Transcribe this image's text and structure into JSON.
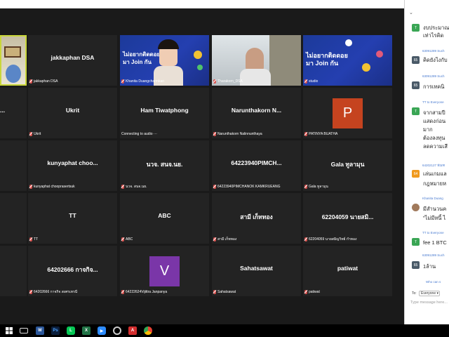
{
  "gallery": {
    "tiles": [
      {
        "name": "",
        "footer": ""
      },
      {
        "name": "jakkaphan DSA",
        "footer": "jakkaphan DSA"
      },
      {
        "name": "",
        "footer": "Khanita Duangcharmkan",
        "banner": "ไม่อยากติดดอย\nมา Join กัน"
      },
      {
        "name": "",
        "footer": "Tharakorn_DSA"
      },
      {
        "name": "",
        "footer": "studio",
        "banner": "ไม่อยากติดดอย\nมา Join กัน"
      },
      {
        "name": "...",
        "footer": ""
      },
      {
        "name": "Ukrit",
        "footer": "Ukrit"
      },
      {
        "name": "Ham Tiwatphong",
        "footer": "Connecting to audio ···"
      },
      {
        "name": "Narunthakorn  N...",
        "footer": "Narunthakorn Nalinnunthaya"
      },
      {
        "name": "",
        "footer": "PATINYA BUATHA",
        "avatar": "P"
      },
      {
        "name": "",
        "footer": ""
      },
      {
        "name": "kunyaphat  choo...",
        "footer": "kunyaphat chooprasertsuk"
      },
      {
        "name": "นวจ. สนจ.นย.",
        "footer": "นวจ. สนจ.นย."
      },
      {
        "name": "64223940PIMCH...",
        "footer": "64223940PIMCHANOK KAMKRUEANG"
      },
      {
        "name": "Gala ทูลามุน",
        "footer": "Gala ทูลามุน"
      },
      {
        "name": "",
        "footer": ""
      },
      {
        "name": "TT",
        "footer": "TT"
      },
      {
        "name": "ABC",
        "footer": "ABC"
      },
      {
        "name": "สามี เก็ททอง",
        "footer": "สามี เก็ททอง"
      },
      {
        "name": "62204059 นายสมิ...",
        "footer": "62204059 นายสมิญวิทย์ กำทอง"
      },
      {
        "name": "",
        "footer": ""
      },
      {
        "name": "64202666 กาจกิจ...",
        "footer": "64202666 กาจกิจ สงศรเทรนี"
      },
      {
        "name": "",
        "footer": "64222624Vijittra Janpanya",
        "avatar": "V"
      },
      {
        "name": "Sahatsawat",
        "footer": "Sahatsawat"
      },
      {
        "name": "patiwat",
        "footer": "patiwat"
      }
    ]
  },
  "chat": {
    "collapse": "⌄",
    "messages": [
      {
        "avatar": "T",
        "sender": "",
        "lines": [
          "งบประมาณ",
          "เท่าไรคิด"
        ]
      },
      {
        "avatar": "65",
        "sender": "63091289 Such",
        "lines": [
          "คิดยังไงกับ"
        ]
      },
      {
        "avatar": "65",
        "sender": "63091289 Such",
        "lines": [
          "การเทคนิ"
        ]
      },
      {
        "avatar": "T",
        "sender": "TT to Everyone",
        "lines": [
          "จากสามปี",
          "แสดงก่อน",
          "มาก",
          "ต้องลงทุน",
          "ลดความเสี"
        ]
      },
      {
        "avatar": "64",
        "sender": "64202127 ทัณฑ",
        "lines": [
          "เล่นเกมแล",
          "กฎหมายห"
        ]
      },
      {
        "avatar": "",
        "sender": "Khanita Duang",
        "lines": [
          "มีสำนวนค",
          "\"ไม่มีหนี้ ไ"
        ]
      },
      {
        "avatar": "T",
        "sender": "TT to Everyone",
        "lines": [
          "fee 1 BTC"
        ]
      },
      {
        "avatar": "65",
        "sender": "63091289 Such",
        "lines": [
          "1ล้าน"
        ]
      }
    ],
    "notice": "Who can s",
    "to_label": "To:",
    "to_value": "Everyone ▾",
    "input_placeholder": "Type message here..."
  },
  "taskbar": {
    "icons": [
      "windows-start-icon",
      "mail-icon",
      "word-icon",
      "photoshop-icon",
      "line-icon",
      "excel-icon",
      "zoom-icon",
      "edge-icon",
      "acrobat-icon",
      "chrome-icon"
    ]
  }
}
